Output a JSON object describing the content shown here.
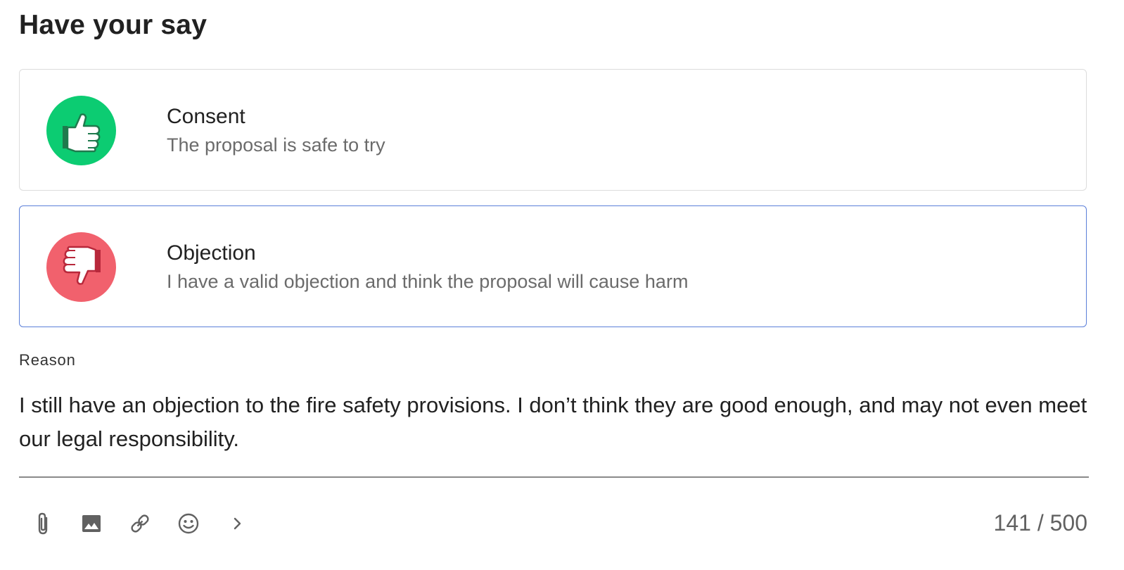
{
  "header": {
    "title": "Have your say"
  },
  "options": [
    {
      "title": "Consent",
      "subtitle": "The proposal is safe to try",
      "icon": "thumbs-up-icon",
      "color": "#0ccc72",
      "selected": false
    },
    {
      "title": "Objection",
      "subtitle": "I have a valid objection and think the proposal will cause harm",
      "icon": "thumbs-down-icon",
      "color": "#f1616d",
      "selected": true
    }
  ],
  "reason": {
    "label": "Reason",
    "value": "I still have an objection to the fire safety provisions. I don’t think they are good enough, and may not even meet our legal responsibility."
  },
  "toolbar": {
    "icons": [
      "attach-icon",
      "image-icon",
      "link-icon",
      "emoji-icon",
      "chevron-right-icon"
    ],
    "counter": "141 / 500"
  },
  "colors": {
    "selected_border": "#5b7fd9",
    "underline": "#8a8a8a"
  }
}
